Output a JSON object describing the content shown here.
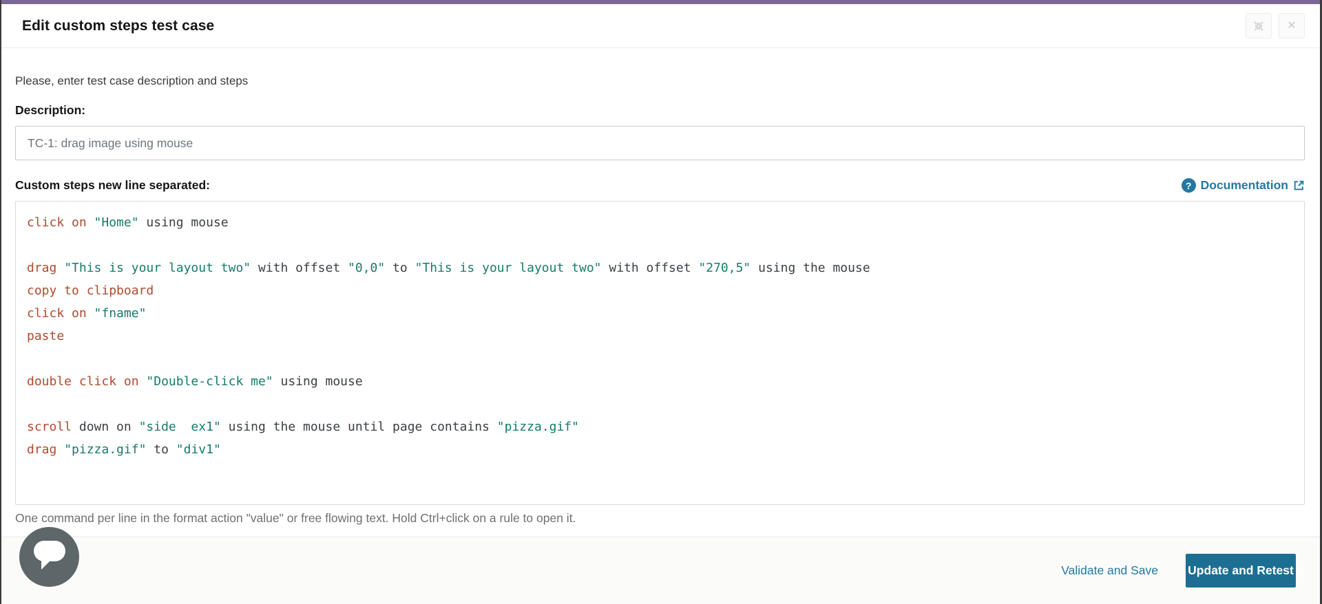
{
  "colors": {
    "top_bar": "#7a6795",
    "accent": "#2478a2",
    "primary_btn_bg": "#1d6e93",
    "primary_btn_text": "#ffffff",
    "code_cmd": "#b04a2f",
    "code_str": "#177a6b",
    "code_txt": "#3b4043"
  },
  "header": {
    "title": "Edit custom steps test case",
    "close_glyph": "✕"
  },
  "form": {
    "intro": "Please, enter test case description and steps",
    "description_label": "Description:",
    "description_value": "TC-1: drag image using mouse",
    "steps_label": "Custom steps new line separated:",
    "documentation": {
      "label": "Documentation",
      "help_glyph": "?"
    },
    "helper_text": "One command per line in the format action \"value\" or free flowing text. Hold Ctrl+click on a rule to open it."
  },
  "editor": {
    "lines": [
      [
        {
          "c": "cmd",
          "t": "click on"
        },
        {
          "c": "txt",
          "t": " "
        },
        {
          "c": "str",
          "t": "\"Home\""
        },
        {
          "c": "txt",
          "t": " using mouse"
        }
      ],
      [],
      [
        {
          "c": "cmd",
          "t": "drag"
        },
        {
          "c": "txt",
          "t": " "
        },
        {
          "c": "str",
          "t": "\"This is your layout two\""
        },
        {
          "c": "txt",
          "t": " with offset "
        },
        {
          "c": "str",
          "t": "\"0,0\""
        },
        {
          "c": "txt",
          "t": " to "
        },
        {
          "c": "str",
          "t": "\"This is your layout two\""
        },
        {
          "c": "txt",
          "t": " with offset "
        },
        {
          "c": "str",
          "t": "\"270,5\""
        },
        {
          "c": "txt",
          "t": " using the mouse"
        }
      ],
      [
        {
          "c": "cmd",
          "t": "copy to clipboard"
        }
      ],
      [
        {
          "c": "cmd",
          "t": "click on"
        },
        {
          "c": "txt",
          "t": " "
        },
        {
          "c": "str",
          "t": "\"fname\""
        }
      ],
      [
        {
          "c": "cmd",
          "t": "paste"
        }
      ],
      [],
      [
        {
          "c": "cmd",
          "t": "double click on"
        },
        {
          "c": "txt",
          "t": " "
        },
        {
          "c": "str",
          "t": "\"Double-click me\""
        },
        {
          "c": "txt",
          "t": " using mouse"
        }
      ],
      [],
      [
        {
          "c": "cmd",
          "t": "scroll"
        },
        {
          "c": "txt",
          "t": " down on "
        },
        {
          "c": "str",
          "t": "\"side  ex1\""
        },
        {
          "c": "txt",
          "t": " using the mouse until page contains "
        },
        {
          "c": "str",
          "t": "\"pizza.gif\""
        }
      ],
      [
        {
          "c": "cmd",
          "t": "drag"
        },
        {
          "c": "txt",
          "t": " "
        },
        {
          "c": "str",
          "t": "\"pizza.gif\""
        },
        {
          "c": "txt",
          "t": " to "
        },
        {
          "c": "str",
          "t": "\"div1\""
        }
      ]
    ]
  },
  "footer": {
    "validate_label": "Validate and Save",
    "update_label": "Update and Retest"
  }
}
